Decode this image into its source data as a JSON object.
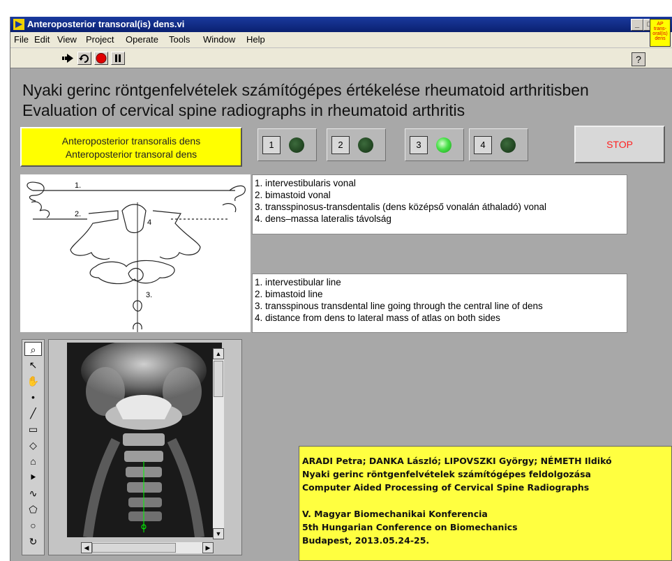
{
  "window": {
    "title": "Anteroposterior transoral(is) dens.vi",
    "buttons": [
      "_",
      "□",
      "x"
    ]
  },
  "menu": [
    "File",
    "Edit",
    "View",
    "Project",
    "Operate",
    "Tools",
    "Window",
    "Help"
  ],
  "toolbar": {
    "icons": [
      "run-arrow-icon",
      "run-continuously-icon",
      "abort-icon",
      "pause-icon"
    ],
    "help_label": "?",
    "vi_icon_text": [
      "AP",
      "trans-",
      "oral(is)",
      "dens"
    ]
  },
  "headings": {
    "line1": "Nyaki gerinc röntgenfelvételek számítógépes értékelése rheumatoid arthritisben",
    "line2": "Evaluation of cervical spine radiographs in rheumatoid arthritis"
  },
  "mode_button": {
    "line1": "Anteroposterior transoralis dens",
    "line2": "Anteroposterior transoral dens"
  },
  "selectors": [
    {
      "label": "1",
      "active": false
    },
    {
      "label": "2",
      "active": false
    },
    {
      "label": "3",
      "active": true
    },
    {
      "label": "4",
      "active": false
    }
  ],
  "stop_label": "STOP",
  "diagram_labels": [
    "1.",
    "2.",
    "3.",
    "4"
  ],
  "legend_hu": [
    "1. intervestibularis vonal",
    "2. bimastoid vonal",
    "3. transspinosus-transdentalis  (dens középső vonalán áthaladó) vonal",
    "4. dens–massa lateralis távolság"
  ],
  "legend_en": [
    "1. intervestibular line",
    "2. bimastoid line",
    "3. transspinous transdental line going through the central line of dens",
    "4. distance from dens to lateral mass of atlas on both sides"
  ],
  "tool_palette": [
    "zoom-icon",
    "arrow-icon",
    "pan-hand-icon",
    "point-icon",
    "line-icon",
    "rectangle-icon",
    "rotated-rect-icon",
    "annulus-icon",
    "polyline-icon",
    "freehand-icon",
    "polygon-icon",
    "oval-icon",
    "broken-line-icon"
  ],
  "info": [
    "ARADI Petra; DANKA László; LIPOVSZKI György; NÉMETH Ildikó",
    "Nyaki gerinc röntgenfelvételek számítógépes feldolgozása",
    "Computer Aided Processing of Cervical Spine Radiographs",
    "",
    "V. Magyar Biomechanikai Konferencia",
    "5th Hungarian Conference on Biomechanics",
    "Budapest, 2013.05.24-25."
  ],
  "colors": {
    "accent_yellow": "#ffff00",
    "led_on": "#49e049",
    "stop_text": "#ff2020",
    "title_bar": "#0a2070"
  }
}
